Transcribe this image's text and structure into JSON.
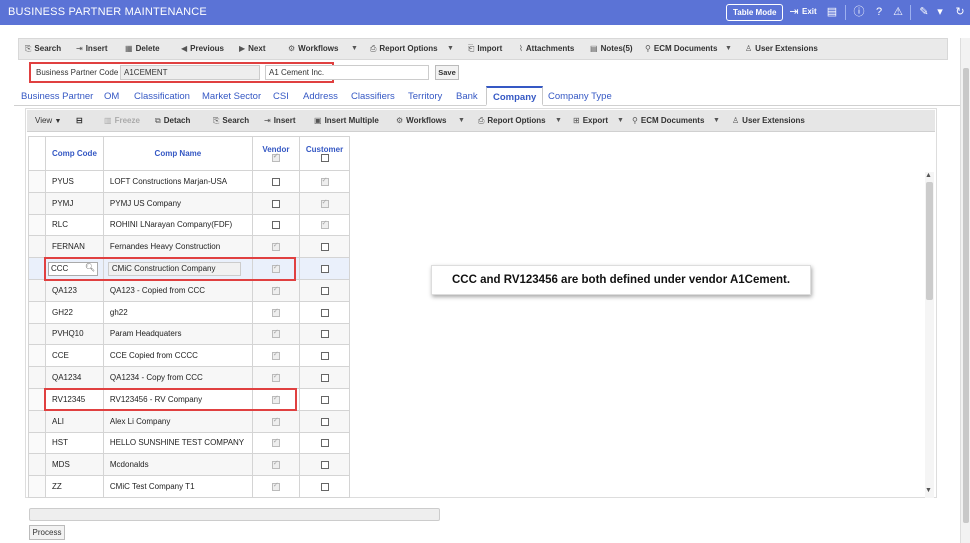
{
  "app": {
    "title": "BUSINESS PARTNER MAINTENANCE",
    "table_mode_label": "Table Mode",
    "exit_label": "Exit"
  },
  "toolbar": {
    "search": "Search",
    "insert": "Insert",
    "delete": "Delete",
    "previous": "Previous",
    "next": "Next",
    "workflows": "Workflows",
    "report_options": "Report Options",
    "import": "Import",
    "attachments": "Attachments",
    "notes": "Notes(5)",
    "ecm_documents": "ECM Documents",
    "user_extensions": "User Extensions"
  },
  "business_partner": {
    "code_label": "Business Partner Code",
    "code_value": "A1CEMENT",
    "name_value": "A1 Cement Inc.",
    "save_label": "Save"
  },
  "tabs": [
    {
      "label": "Business Partner"
    },
    {
      "label": "OM"
    },
    {
      "label": "Classification"
    },
    {
      "label": "Market Sector"
    },
    {
      "label": "CSI"
    },
    {
      "label": "Address"
    },
    {
      "label": "Classifiers"
    },
    {
      "label": "Territory"
    },
    {
      "label": "Bank"
    },
    {
      "label": "Company"
    },
    {
      "label": "Company Type"
    }
  ],
  "active_tab": "Company",
  "grid_toolbar": {
    "view": "View",
    "freeze": "Freeze",
    "detach": "Detach",
    "search": "Search",
    "insert": "Insert",
    "insert_multiple": "Insert Multiple",
    "workflows": "Workflows",
    "report_options": "Report Options",
    "export": "Export",
    "ecm_documents": "ECM Documents",
    "user_extensions": "User Extensions"
  },
  "grid": {
    "columns": {
      "comp_code": "Comp Code",
      "comp_name": "Comp Name",
      "vendor": "Vendor",
      "customer": "Customer"
    },
    "rows": [
      {
        "code": "PYUS",
        "name": "LOFT Constructions Marjan-USA",
        "vendor": false,
        "customer": true
      },
      {
        "code": "PYMJ",
        "name": "PYMJ US Company",
        "vendor": false,
        "customer": true
      },
      {
        "code": "RLC",
        "name": "ROHINI LNarayan Company(FDF)",
        "vendor": false,
        "customer": true
      },
      {
        "code": "FERNAN",
        "name": "Fernandes Heavy Construction",
        "vendor": true,
        "customer": false
      },
      {
        "code": "CCC",
        "name": "CMiC Construction Company",
        "vendor": true,
        "customer": false
      },
      {
        "code": "QA123",
        "name": "QA123 - Copied from CCC",
        "vendor": true,
        "customer": false
      },
      {
        "code": "GH22",
        "name": "gh22",
        "vendor": true,
        "customer": false
      },
      {
        "code": "PVHQ10",
        "name": "Param Headquaters",
        "vendor": true,
        "customer": false
      },
      {
        "code": "CCE",
        "name": "CCE Copied from CCCC",
        "vendor": true,
        "customer": false
      },
      {
        "code": "QA1234",
        "name": "QA1234 - Copy from CCC",
        "vendor": true,
        "customer": false
      },
      {
        "code": "RV12345",
        "name": "RV123456 - RV Company",
        "vendor": true,
        "customer": false
      },
      {
        "code": "ALI",
        "name": "Alex Li Company",
        "vendor": true,
        "customer": false
      },
      {
        "code": "HST",
        "name": "HELLO SUNSHINE TEST COMPANY",
        "vendor": true,
        "customer": false
      },
      {
        "code": "MDS",
        "name": "Mcdonalds",
        "vendor": true,
        "customer": false
      },
      {
        "code": "ZZ",
        "name": "CMiC Test Company T1",
        "vendor": true,
        "customer": false
      }
    ]
  },
  "callout": "CCC and RV123456 are both defined under vendor A1Cement.",
  "process_label": "Process",
  "colors": {
    "titlebar": "#5b73d6",
    "link": "#3558c4",
    "highlight_box": "#e04040"
  }
}
